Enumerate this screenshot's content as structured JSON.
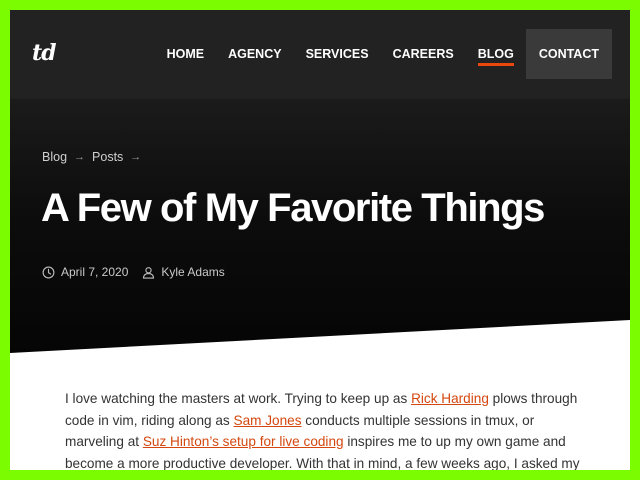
{
  "header": {
    "logo_text": "td",
    "nav": [
      {
        "label": "HOME",
        "active": false
      },
      {
        "label": "AGENCY",
        "active": false
      },
      {
        "label": "SERVICES",
        "active": false
      },
      {
        "label": "CAREERS",
        "active": false
      },
      {
        "label": "BLOG",
        "active": true
      },
      {
        "label": "CONTACT",
        "active": false
      }
    ]
  },
  "breadcrumb": {
    "items": [
      "Blog",
      "Posts"
    ],
    "separator": "→"
  },
  "post": {
    "title": "A Few of My Favorite Things",
    "date": "April 7, 2020",
    "author": "Kyle Adams",
    "date_icon": "clock-icon",
    "author_icon": "user-icon"
  },
  "content": {
    "t1": "I love watching the masters at work. Trying to keep up as ",
    "link1": "Rick Harding",
    "t2": " plows through code in vim, riding along as ",
    "link2": "Sam Jones",
    "t3": " conducts multiple sessions in tmux, or marveling at ",
    "link3": "Suz Hinton’s setup for live coding",
    "t4": " inspires me to up my own game and become a more productive developer. With that in mind, a few weeks ago, I asked my fellow Test Double"
  },
  "colors": {
    "accent": "#e8480c",
    "link": "#d4470f",
    "hero_bg": "#0d0d0d",
    "border": "#7CFC00"
  }
}
